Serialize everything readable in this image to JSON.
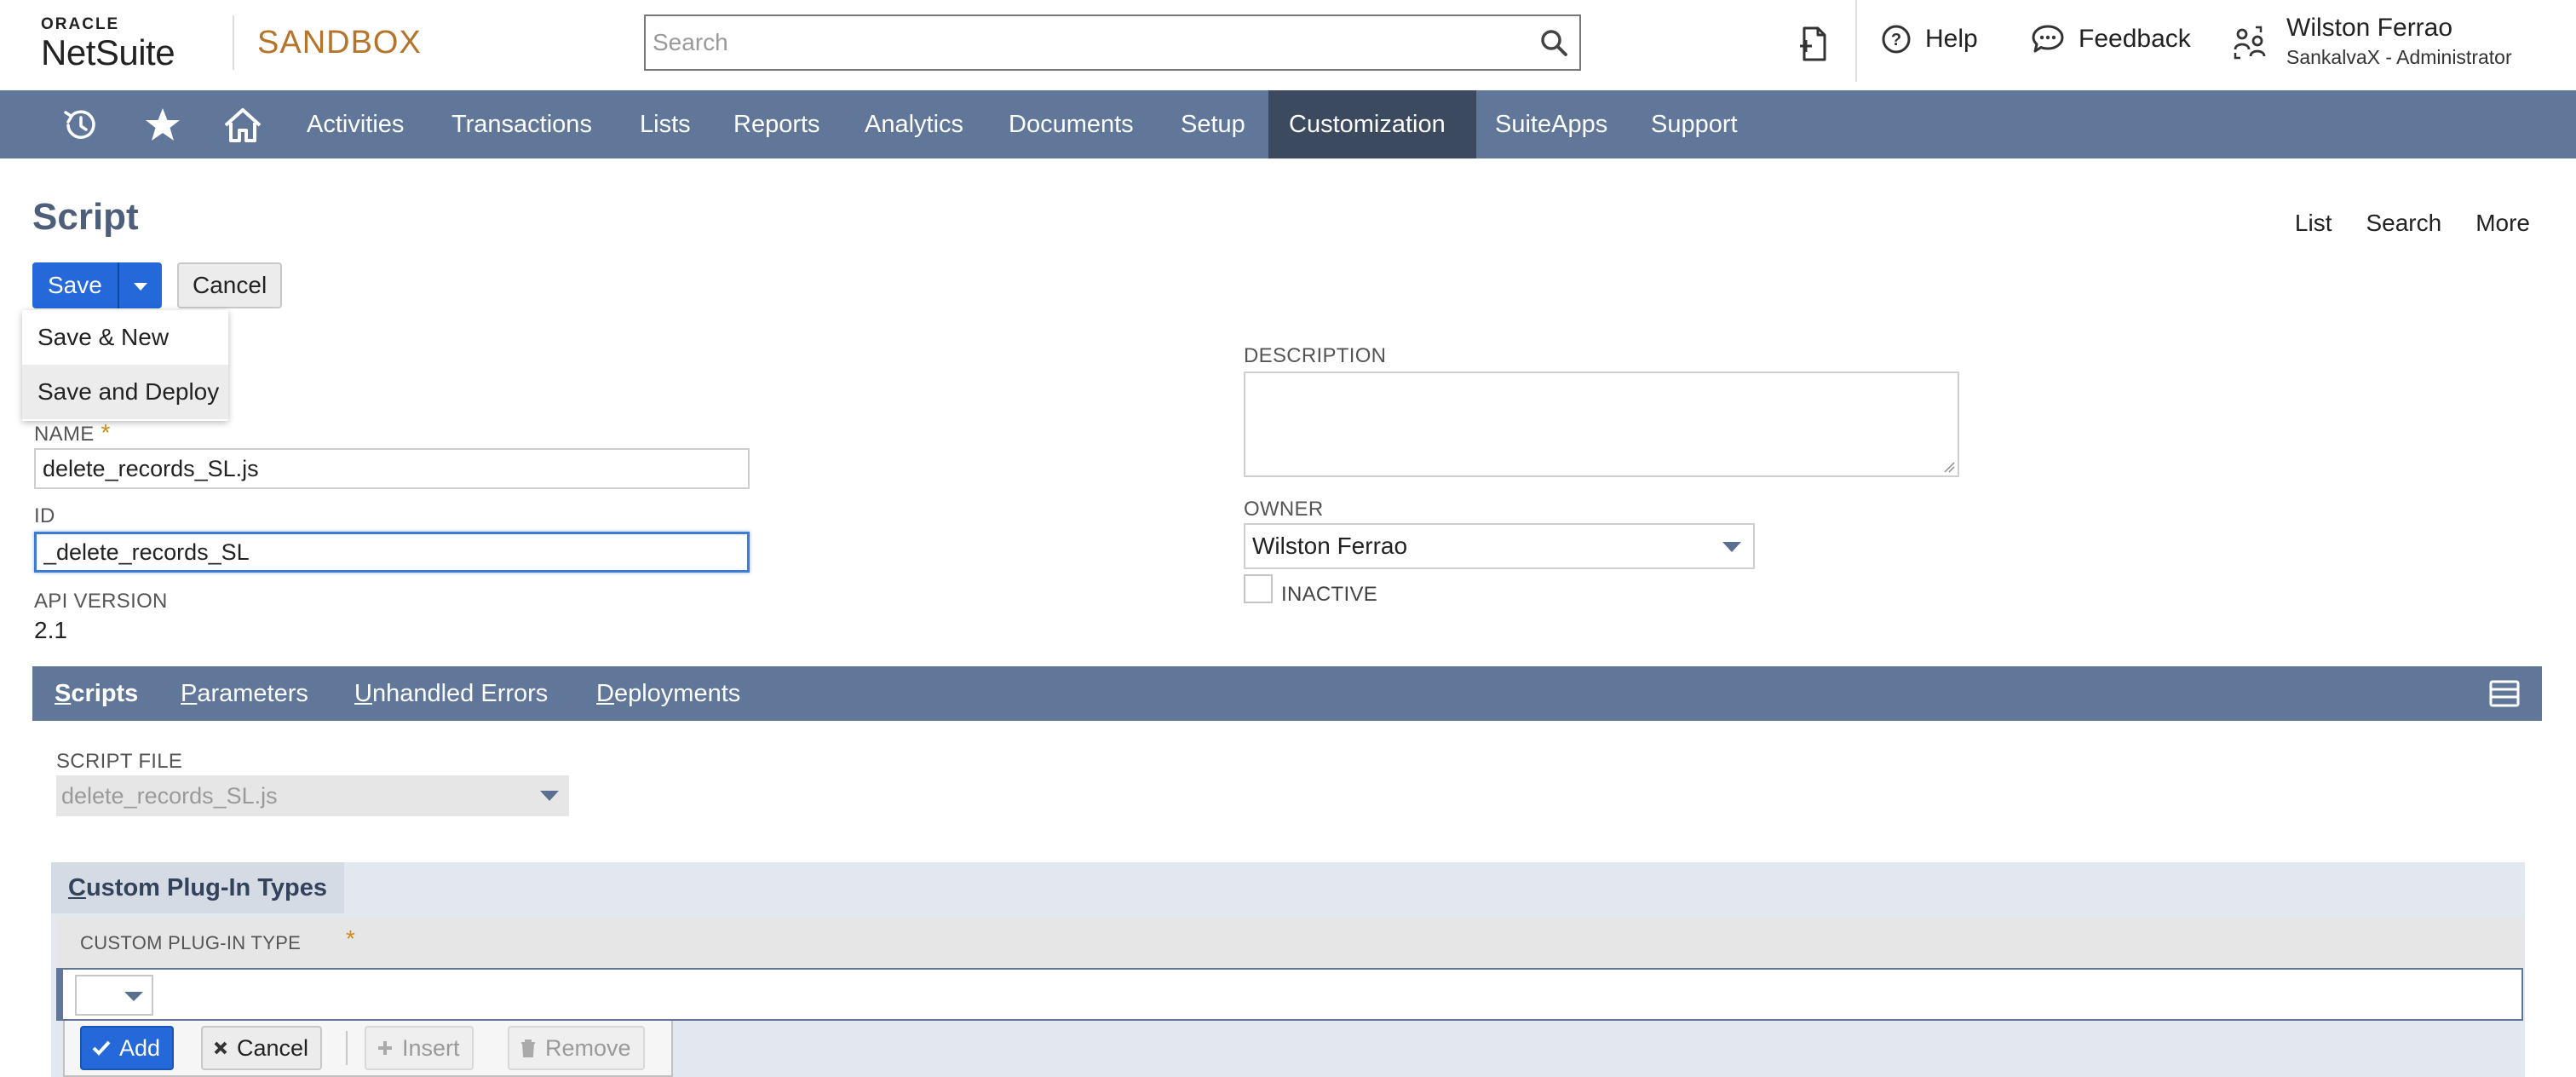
{
  "header": {
    "logo_oracle": "ORACLE",
    "logo_netsuite": "NetSuite",
    "environment": "SANDBOX",
    "search_placeholder": "Search",
    "help_label": "Help",
    "feedback_label": "Feedback",
    "user_name": "Wilston Ferrao",
    "user_role": "SankalvaX - Administrator"
  },
  "nav": {
    "items": [
      "Activities",
      "Transactions",
      "Lists",
      "Reports",
      "Analytics",
      "Documents",
      "Setup",
      "Customization",
      "SuiteApps",
      "Support"
    ],
    "active": "Customization",
    "bg_color": "#607799",
    "active_color": "#3b4a5f"
  },
  "page": {
    "title": "Script",
    "links": [
      "List",
      "Search",
      "More"
    ]
  },
  "buttons": {
    "save": "Save",
    "cancel": "Cancel"
  },
  "save_menu": {
    "items": [
      "Save & New",
      "Save and Deploy"
    ],
    "highlighted": "Save and Deploy"
  },
  "form": {
    "name_label": "NAME",
    "name_value": "delete_records_SL.js",
    "id_label": "ID",
    "id_value": "_delete_records_SL",
    "api_version_label": "API VERSION",
    "api_version_value": "2.1",
    "description_label": "DESCRIPTION",
    "description_value": "",
    "owner_label": "OWNER",
    "owner_value": "Wilston Ferrao",
    "inactive_label": "INACTIVE",
    "inactive_checked": false,
    "required_marker": "*"
  },
  "subtabs": {
    "items": [
      {
        "key": "S",
        "rest": "cripts"
      },
      {
        "key": "P",
        "rest": "arameters"
      },
      {
        "key": "U",
        "rest": "nhandled Errors"
      },
      {
        "key": "D",
        "rest": "eployments"
      }
    ],
    "active": "Scripts"
  },
  "scripts_tab": {
    "script_file_label": "SCRIPT FILE",
    "script_file_value": "delete_records_SL.js"
  },
  "custom_plugin": {
    "tab_key": "C",
    "tab_rest": "ustom Plug-In Types",
    "column_header": "CUSTOM PLUG-IN TYPE",
    "actions": {
      "add": "Add",
      "cancel": "Cancel",
      "insert": "Insert",
      "remove": "Remove"
    }
  },
  "colors": {
    "accent_blue": "#2468d9",
    "sandbox_orange": "#b6742b",
    "title_slate": "#4d5f7a",
    "required": "#d48a13"
  }
}
